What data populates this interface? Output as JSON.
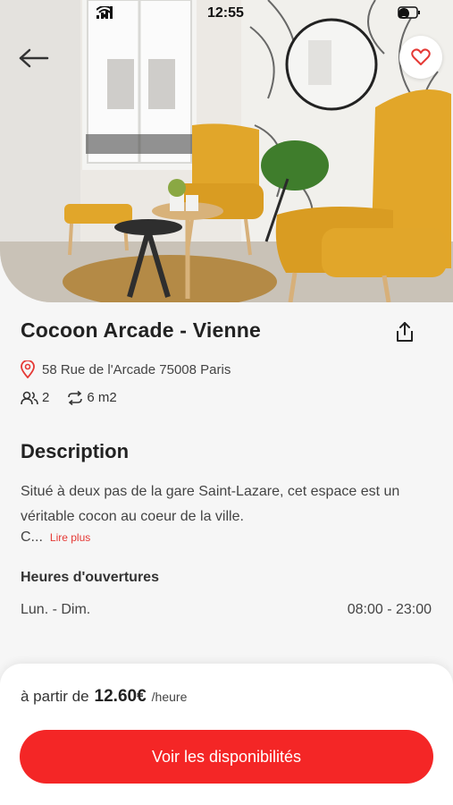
{
  "status_bar": {
    "time": "12:55"
  },
  "header": {
    "back_icon": "arrow-left-icon",
    "favorite_icon": "heart-icon"
  },
  "space": {
    "title": "Cocoon Arcade - Vienne",
    "address": "58 Rue de l'Arcade 75008 Paris",
    "capacity": "2",
    "area": "6 m2"
  },
  "description": {
    "heading": "Description",
    "text": "Situé à deux pas de la gare Saint-Lazare, cet espace est un véritable cocon au coeur de la ville.",
    "truncated": "C...",
    "read_more": "Lire plus"
  },
  "hours": {
    "heading": "Heures d'ouvertures",
    "days": "Lun. - Dim.",
    "time": "08:00 - 23:00"
  },
  "pricing": {
    "prefix": "à partir de",
    "price": "12.60€",
    "unit": "/heure"
  },
  "cta": {
    "label": "Voir les disponibilités"
  },
  "colors": {
    "accent": "#f42626",
    "pin": "#e53935",
    "chair": "#e1a62a"
  }
}
